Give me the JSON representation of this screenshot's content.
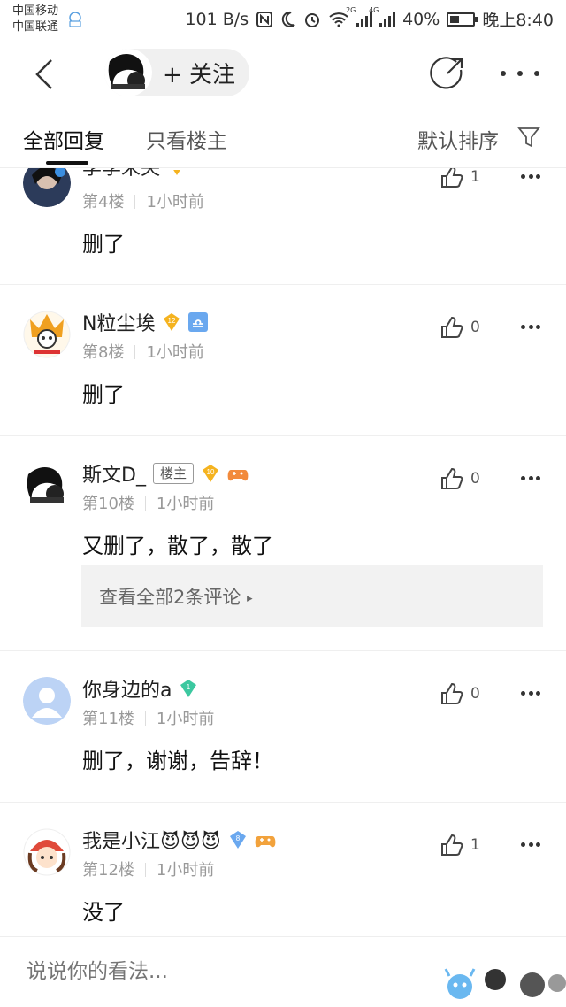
{
  "status": {
    "carrier1": "中国移动",
    "carrier2": "中国联通",
    "speed": "101 B/s",
    "net1": "2G",
    "net2": "4G",
    "battery": "40%",
    "time": "晚上8:40"
  },
  "nav": {
    "follow_label": "+ 关注"
  },
  "tabs": {
    "all": "全部回复",
    "op_only": "只看楼主",
    "sort": "默认排序"
  },
  "posts": [
    {
      "name": "李李未央",
      "floor": "第4楼",
      "time": "1小时前",
      "text": "删了",
      "likes": "1"
    },
    {
      "name": "N粒尘埃",
      "level": "12",
      "floor": "第8楼",
      "time": "1小时前",
      "text": "删了",
      "likes": "0"
    },
    {
      "name": "斯文D_",
      "op_badge": "楼主",
      "level": "10",
      "floor": "第10楼",
      "time": "1小时前",
      "text": "又删了，散了，散了",
      "likes": "0",
      "sub_link": "查看全部2条评论"
    },
    {
      "name": "你身边的a",
      "level": "1",
      "floor": "第11楼",
      "time": "1小时前",
      "text": "删了，谢谢，告辞！",
      "likes": "0"
    },
    {
      "name": "我是小江😈😈😈",
      "level": "8",
      "floor": "第12楼",
      "time": "1小时前",
      "text": "没了",
      "likes": "1"
    }
  ],
  "comment_bar": {
    "placeholder": "说说你的看法..."
  },
  "colors": {
    "gold_badge": "#f5b31f",
    "green_badge": "#3cc8a0",
    "blue_badge": "#6aa8ef",
    "orange_badge": "#f28a3c"
  }
}
